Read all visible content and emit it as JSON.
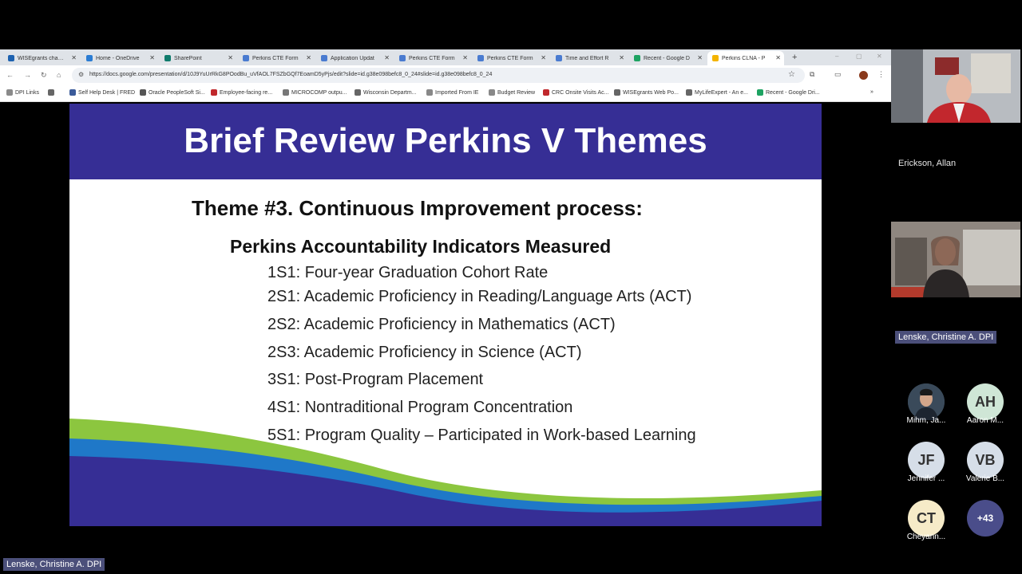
{
  "browser": {
    "tabs": [
      {
        "label": "WISEgrants chang",
        "color": "#1e62b0"
      },
      {
        "label": "Home - OneDrive",
        "color": "#2b7cd3"
      },
      {
        "label": "SharePoint",
        "color": "#0f7b6c"
      },
      {
        "label": "Perkins CTE Form",
        "color": "#4a7bd0"
      },
      {
        "label": "Application Updat",
        "color": "#4a7bd0"
      },
      {
        "label": "Perkins CTE Form",
        "color": "#4a7bd0"
      },
      {
        "label": "Perkins CTE Form",
        "color": "#4a7bd0"
      },
      {
        "label": "Time and Effort R",
        "color": "#4a7bd0"
      },
      {
        "label": "Recent - Google D",
        "color": "#1ea362"
      },
      {
        "label": "Perkins CLNA - P",
        "color": "#f4b400"
      }
    ],
    "url": "https://docs.google.com/presentation/d/10J9YuUrRkG8POodBu_uVfAOL7FSZbGQf7EoamD5yPjs/edit?slide=id.g38e098befc8_0_24#slide=id.g38e098befc8_0_24",
    "bookmarks": [
      {
        "label": "DPI Links",
        "color": "#8a8a8a"
      },
      {
        "label": "",
        "color": "#666"
      },
      {
        "label": "Self Help Desk | FRED",
        "color": "#3b5b9a"
      },
      {
        "label": "Oracle PeopleSoft Si...",
        "color": "#555"
      },
      {
        "label": "Employee-facing re...",
        "color": "#c0282c"
      },
      {
        "label": "MICROCOMP outpu...",
        "color": "#777"
      },
      {
        "label": "Wisconsin Departm...",
        "color": "#666"
      },
      {
        "label": "Imported From IE",
        "color": "#888"
      },
      {
        "label": "Budget Review",
        "color": "#888"
      },
      {
        "label": "CRC Onsite Visits Ac...",
        "color": "#c0282c"
      },
      {
        "label": "WISEgrants Web Po...",
        "color": "#666"
      },
      {
        "label": "MyLifeExpert - An e...",
        "color": "#666"
      },
      {
        "label": "Recent - Google Dri...",
        "color": "#1ea362"
      }
    ]
  },
  "slide": {
    "title": "Brief Review Perkins V Themes",
    "theme": "Theme #3.  Continuous Improvement process:",
    "indicators_heading": "Perkins Accountability Indicators Measured",
    "indicators": [
      "1S1:  Four-year Graduation Cohort Rate",
      "2S1:  Academic Proficiency in Reading/Language Arts (ACT)",
      "2S2:  Academic Proficiency in Mathematics (ACT)",
      "2S3:  Academic Proficiency in Science (ACT)",
      "3S1:  Post-Program Placement",
      "4S1:  Nontraditional Program Concentration",
      "5S1:  Program Quality – Participated in Work-based Learning"
    ],
    "colors": {
      "header": "#362e95",
      "wave_green": "#8cc63f",
      "wave_blue": "#1f78c8",
      "wave_navy": "#362e95"
    }
  },
  "participants": {
    "video1_name": "Erickson, Allan",
    "video2_name": "Lenske, Christine A.  DPI",
    "avatars": [
      {
        "initials": "",
        "name": "Mihm, Ja...",
        "bg": "#3a4a5a"
      },
      {
        "initials": "AH",
        "name": "Aaron M...",
        "bg": "#cfe6d6"
      },
      {
        "initials": "JF",
        "name": "Jennifer ...",
        "bg": "#d6dee8"
      },
      {
        "initials": "VB",
        "name": "Valerie B...",
        "bg": "#d6dee8"
      },
      {
        "initials": "CT",
        "name": "Cheyann...",
        "bg": "#f6ebc8"
      }
    ],
    "more_count": "+43"
  },
  "speaker_label": "Lenske, Christine A.  DPI"
}
